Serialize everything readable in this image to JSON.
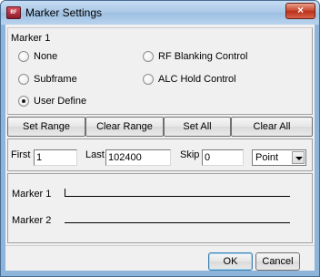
{
  "window": {
    "title": "Marker Settings",
    "app_icon_text": "RF",
    "close_glyph": "×",
    "accent_color": "#8fb4d9"
  },
  "marker_group": {
    "label": "Marker 1",
    "options": [
      {
        "label": "None",
        "selected": false
      },
      {
        "label": "Subframe",
        "selected": false
      },
      {
        "label": "User Define",
        "selected": true
      },
      {
        "label": "RF Blanking Control",
        "selected": false
      },
      {
        "label": "ALC Hold Control",
        "selected": false
      }
    ]
  },
  "buttons": {
    "set_range": "Set Range",
    "clear_range": "Clear Range",
    "set_all": "Set All",
    "clear_all": "Clear All"
  },
  "range": {
    "first_label": "First",
    "first_value": "1",
    "last_label": "Last",
    "last_value": "102400",
    "skip_label": "Skip",
    "skip_value": "0",
    "unit_selected": "Point"
  },
  "markers": {
    "marker1_label": "Marker 1",
    "marker2_label": "Marker 2"
  },
  "footer": {
    "ok": "OK",
    "cancel": "Cancel"
  }
}
